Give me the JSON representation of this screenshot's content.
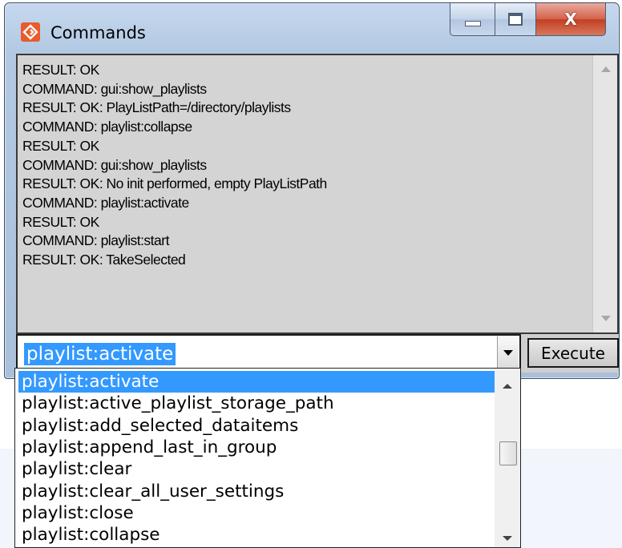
{
  "window": {
    "title": "Commands",
    "close_glyph": "X",
    "icon": "app-logo-icon",
    "accent": "#e85b2c"
  },
  "output": {
    "lines": [
      "RESULT: OK",
      "COMMAND: gui:show_playlists",
      "RESULT: OK: PlayListPath=/directory/playlists",
      "COMMAND: playlist:collapse",
      "RESULT: OK",
      "COMMAND: gui:show_playlists",
      "RESULT: OK: No init performed, empty PlayListPath",
      "COMMAND: playlist:activate",
      "RESULT: OK",
      "COMMAND: playlist:start",
      "RESULT: OK: TakeSelected"
    ]
  },
  "command": {
    "value": "playlist:activate",
    "execute_label": "Execute",
    "options": [
      "playlist:activate",
      "playlist:active_playlist_storage_path",
      "playlist:add_selected_dataitems",
      "playlist:append_last_in_group",
      "playlist:clear",
      "playlist:clear_all_user_settings",
      "playlist:close",
      "playlist:collapse"
    ],
    "selected_index": 0
  }
}
